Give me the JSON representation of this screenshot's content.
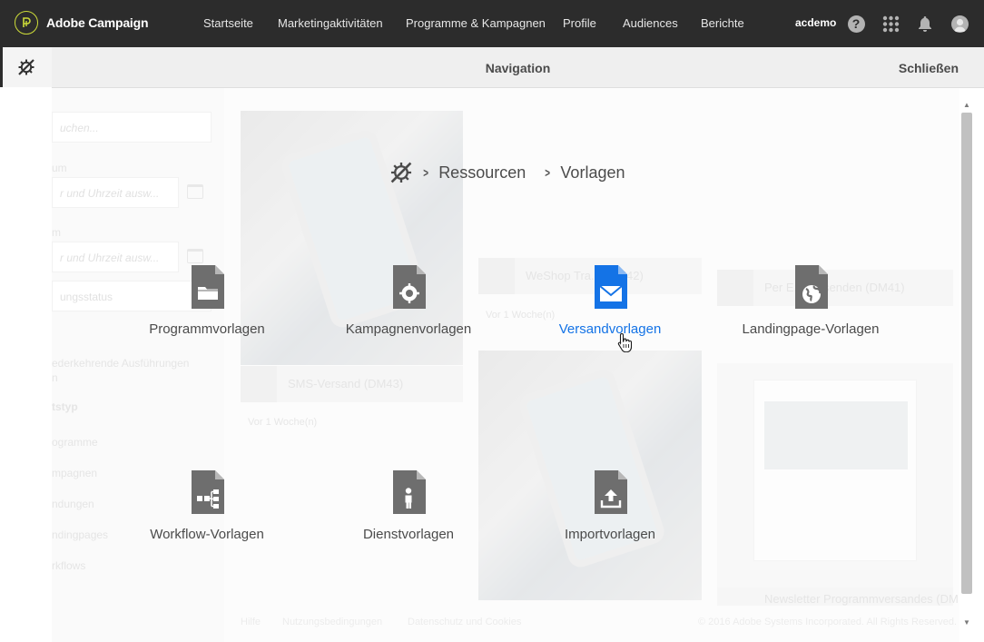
{
  "app": {
    "brand": "Adobe Campaign",
    "nav": [
      "Startseite",
      "Marketingaktivitäten",
      "Programme & Kampagnen",
      "Profile",
      "Audiences",
      "Berichte"
    ],
    "user": "acdemo",
    "icons": {
      "logo": "adobe-campaign-logo",
      "help": "help-icon",
      "apps": "apps-grid-icon",
      "notifications": "bell-icon",
      "avatar": "user-avatar"
    }
  },
  "rail": {
    "active_icon": "resources-icon"
  },
  "panel": {
    "title": "Navigation",
    "close": "Schließen"
  },
  "breadcrumb": {
    "icon": "resources-icon",
    "items": [
      "Ressourcen",
      "Vorlagen"
    ]
  },
  "tiles": [
    {
      "label": "Programmvorlagen",
      "icon": "folder-document-icon"
    },
    {
      "label": "Kampagnenvorlagen",
      "icon": "target-document-icon"
    },
    {
      "label": "Versandvorlagen",
      "icon": "mail-document-icon",
      "active": true
    },
    {
      "label": "Landingpage-Vorlagen",
      "icon": "globe-document-icon"
    },
    {
      "label": "Workflow-Vorlagen",
      "icon": "workflow-document-icon"
    },
    {
      "label": "Dienstvorlagen",
      "icon": "person-document-icon"
    },
    {
      "label": "Importvorlagen",
      "icon": "upload-document-icon"
    }
  ],
  "background": {
    "search_placeholder": "uchen...",
    "field1_label": "um",
    "field1_placeholder": "r und Uhrzeit ausw...",
    "field2_label": "m",
    "field2_placeholder": "r und Uhrzeit ausw...",
    "status_placeholder": "ungsstatus",
    "recurring": "ederkehrende Ausführungen",
    "recurring2": "n",
    "type_heading": "tstyp",
    "types": [
      "ogramme",
      "mpagnen",
      "ndungen",
      "ndingpages",
      "rkflows"
    ],
    "cards": [
      {
        "title": "SMS-Versand (DM43)",
        "meta": "Vor 1 Woche(n)"
      },
      {
        "title": "WeShop Tra... (DM42)",
        "meta": "Vor 1 Woche(n)"
      },
      {
        "title": "Per E... versenden (DM41)",
        "meta": ""
      },
      {
        "title": "Newsletter Programmversandes (DM",
        "meta": ""
      }
    ],
    "footer": [
      "Hilfe",
      "Nutzungsbedingungen",
      "Datenschutz und Cookies"
    ],
    "copyright": "© 2016 Adobe Systems Incorporated. All Rights Reserved."
  },
  "colors": {
    "topbar": "#2c2c2c",
    "accent": "#1473e6",
    "icon_gray": "#6e6e6e",
    "text": "#4b4b4b"
  }
}
